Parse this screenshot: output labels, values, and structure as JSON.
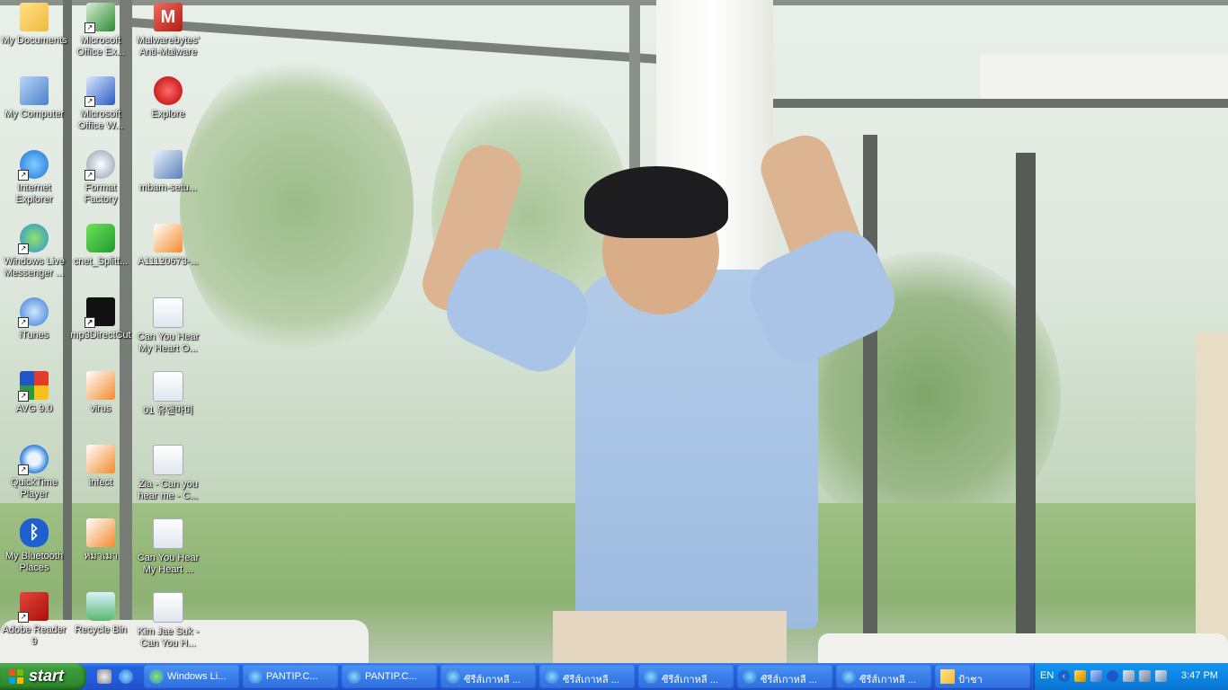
{
  "desktop_icons": [
    {
      "label": "My Documents"
    },
    {
      "label": "My Computer"
    },
    {
      "label": "Internet\nExplorer"
    },
    {
      "label": "Windows Live\nMessenger ..."
    },
    {
      "label": "iTunes"
    },
    {
      "label": "AVG 9.0"
    },
    {
      "label": "QuickTime\nPlayer"
    },
    {
      "label": "My Bluetooth\nPlaces"
    },
    {
      "label": "Adobe Reader\n9"
    },
    {
      "label": "Microsoft\nOffice Ex..."
    },
    {
      "label": "Microsoft\nOffice W..."
    },
    {
      "label": "Format\nFactory"
    },
    {
      "label": "cnet_Splitt..."
    },
    {
      "label": "mp3DirectCut"
    },
    {
      "label": "virus"
    },
    {
      "label": "infect"
    },
    {
      "label": "หมาเมา"
    },
    {
      "label": "Recycle Bin"
    },
    {
      "label": "Malwarebytes'\nAnti-Malware"
    },
    {
      "label": "Explore"
    },
    {
      "label": "mbam-setu..."
    },
    {
      "label": "A11120673-..."
    },
    {
      "label": "Can You Hear\nMy Heart O..."
    },
    {
      "label": "01 유앤마미"
    },
    {
      "label": "Zia - Can you\nhear me - C..."
    },
    {
      "label": "Can You Hear\nMy Heart ..."
    },
    {
      "label": "Kim Jae Suk -\nCan You H..."
    }
  ],
  "taskbar": {
    "start_label": "start",
    "tasks": [
      {
        "label": "Windows Li..."
      },
      {
        "label": "PANTIP.C..."
      },
      {
        "label": "PANTIP.C..."
      },
      {
        "label": "ซีรีส์เกาหลี ..."
      },
      {
        "label": "ซีรีส์เกาหลี ..."
      },
      {
        "label": "ซีรีส์เกาหลี ..."
      },
      {
        "label": "ซีรีส์เกาหลี ..."
      },
      {
        "label": "ซีรีส์เกาหลี ..."
      },
      {
        "label": "ป้าชา"
      }
    ],
    "tray": {
      "language": "EN",
      "clock": "3:47 PM"
    }
  },
  "colors": {
    "taskbar": "#245edb",
    "start_button": "#3c9d3c",
    "tray": "#0d86e3"
  }
}
